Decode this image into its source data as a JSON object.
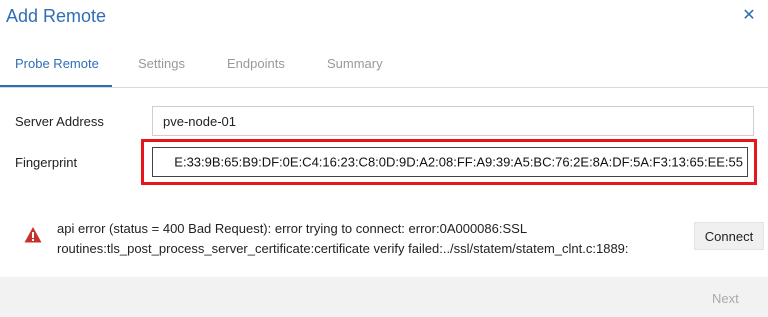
{
  "dialog": {
    "title": "Add Remote"
  },
  "tabs": [
    {
      "label": "Probe Remote",
      "active": true
    },
    {
      "label": "Settings",
      "active": false
    },
    {
      "label": "Endpoints",
      "active": false
    },
    {
      "label": "Summary",
      "active": false
    }
  ],
  "form": {
    "server_address_label": "Server Address",
    "server_address_value": "pve-node-01",
    "fingerprint_label": "Fingerprint",
    "fingerprint_value": "E:33:9B:65:B9:DF:0E:C4:16:23:C8:0D:9D:A2:08:FF:A9:39:A5:BC:76:2E:8A:DF:5A:F3:13:65:EE:55"
  },
  "error": {
    "icon": "warning-icon",
    "line1": "api error (status = 400 Bad Request): error trying to connect: error:0A000086:SSL",
    "line2": "routines:tls_post_process_server_certificate:certificate verify failed:../ssl/statem/statem_clnt.c:1889:"
  },
  "buttons": {
    "close_icon": "close-icon",
    "connect_label": "Connect",
    "next_label": "Next"
  },
  "colors": {
    "accent": "#2f6eb5",
    "highlight": "#e8161b",
    "warning": "#c9302c"
  }
}
